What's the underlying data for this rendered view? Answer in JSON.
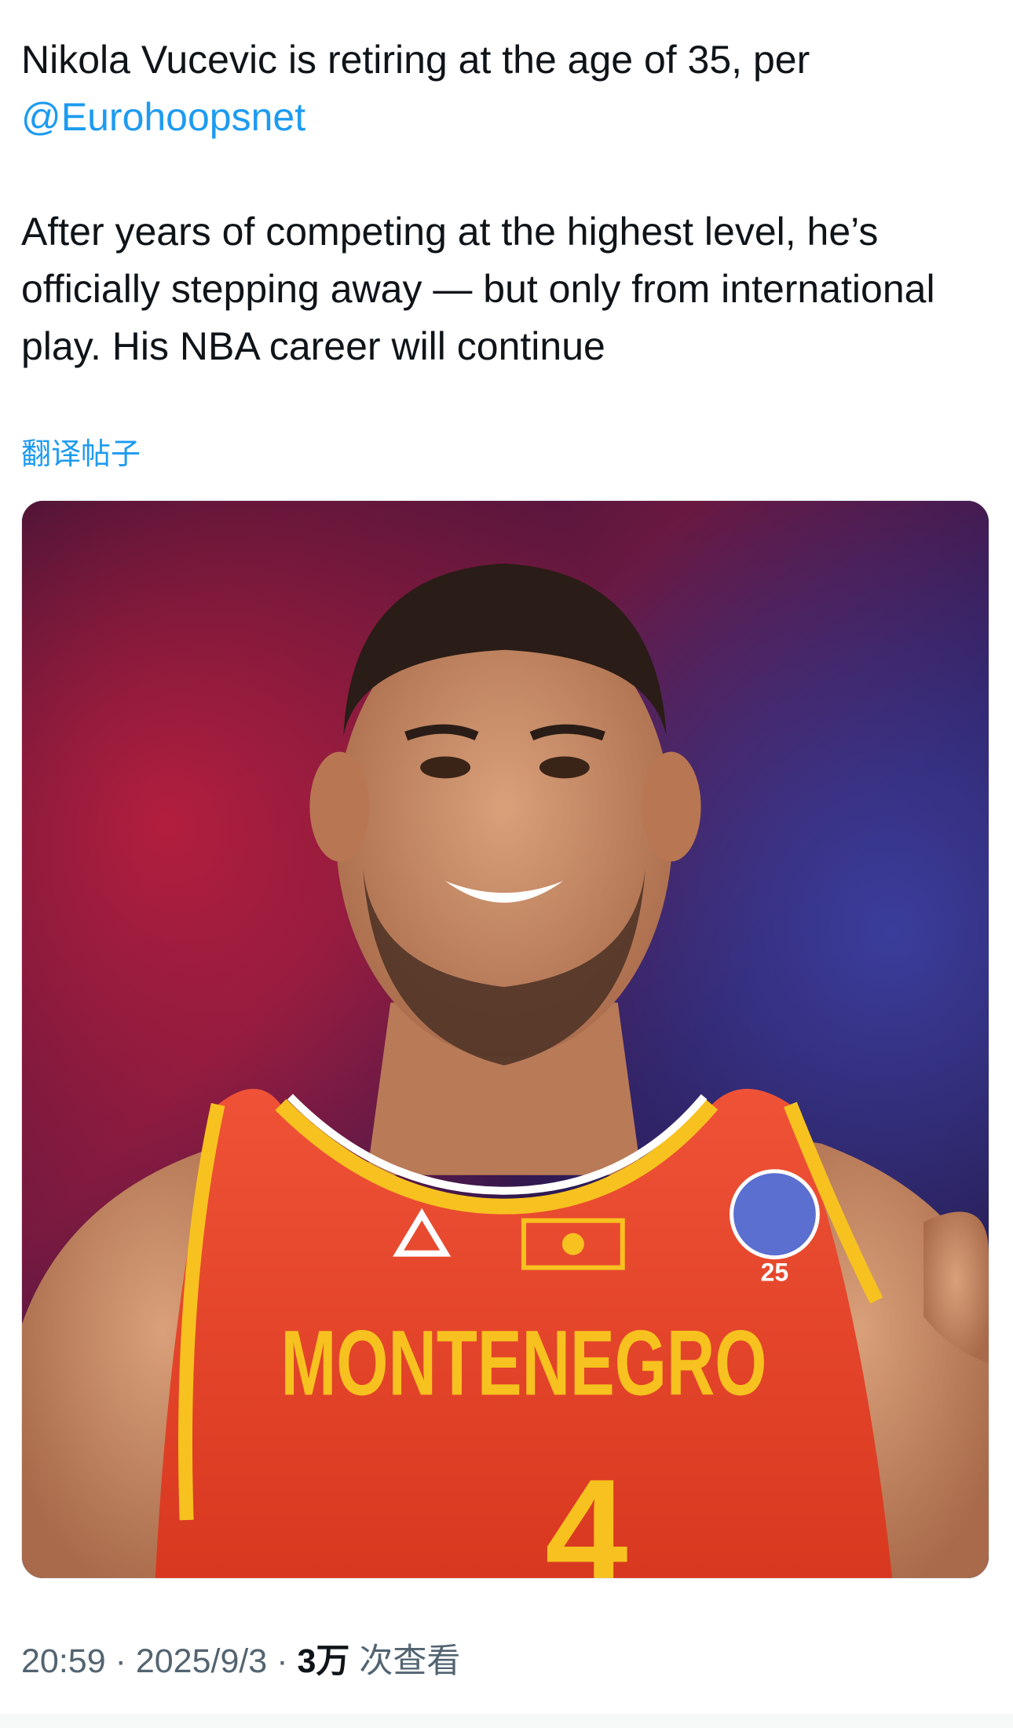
{
  "tweet": {
    "line1": "Nikola Vucevic is retiring at the age of 35, per",
    "mention": "@Eurohoopsnet",
    "paragraph2": "After years of competing at the highest level, he’s officially stepping away — but only from international play. His NBA career will continue",
    "translate_label": "翻译帖子"
  },
  "media": {
    "jersey_text": "MONTENEGRO",
    "jersey_number": "4",
    "logo_text": "25",
    "colors": {
      "jersey": "#e8452c",
      "trim": "#f7c21f",
      "background_dark": "#2a1030",
      "background_red": "#b8203a",
      "background_blue": "#3a3a9a"
    }
  },
  "meta": {
    "time": "20:59",
    "separator": "·",
    "date": "2025/9/3",
    "views_count": "3万",
    "views_label": "次查看"
  },
  "colors": {
    "link": "#1d9bf0",
    "text": "#0f1419",
    "muted": "#536471"
  }
}
